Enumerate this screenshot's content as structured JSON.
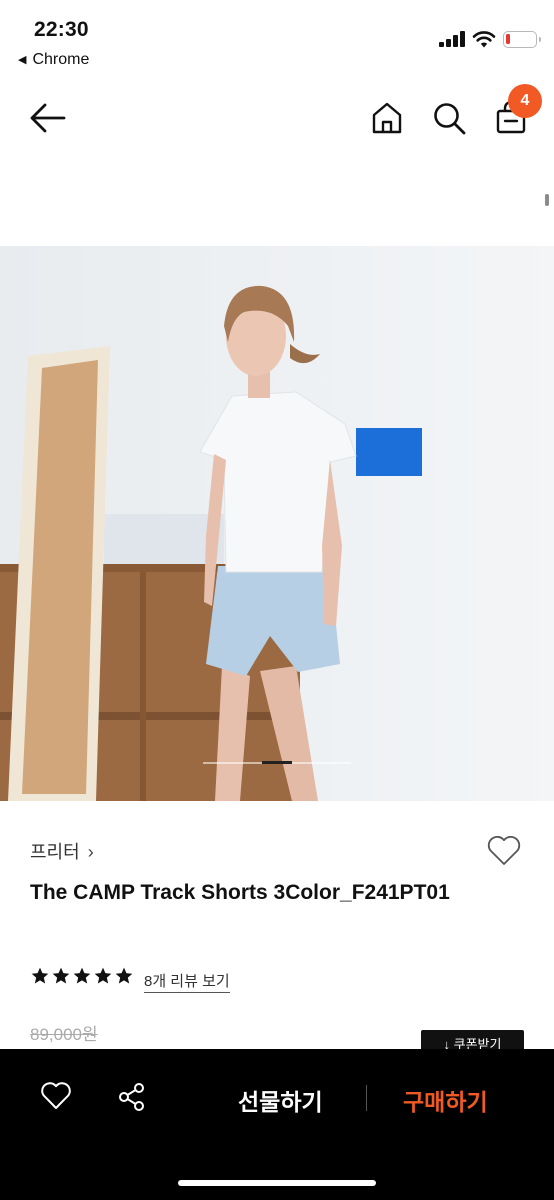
{
  "status_bar": {
    "time": "22:30",
    "back_app": "Chrome",
    "back_arrow": "◀"
  },
  "nav": {
    "back_icon": "arrow-left-icon",
    "home_icon": "home-icon",
    "search_icon": "search-icon",
    "cart_icon": "shopping-bag-icon",
    "cart_count": "4",
    "badge_color": "#f15a24"
  },
  "product": {
    "image_description_icon": "product-photo",
    "brand": "프리터",
    "brand_chevron": "›",
    "title": "The CAMP Track Shorts 3Color_F241PT01",
    "rating_stars": 5,
    "review_link": "8개 리뷰 보기",
    "original_price": "89,000원",
    "coupon_label": "↓ 쿠폰받기",
    "image_page": 2,
    "image_pages": 5
  },
  "bottom_bar": {
    "wish_icon": "heart-icon",
    "share_icon": "share-icon",
    "gift_label": "선물하기",
    "buy_label": "구매하기",
    "buy_color": "#f15a24"
  }
}
